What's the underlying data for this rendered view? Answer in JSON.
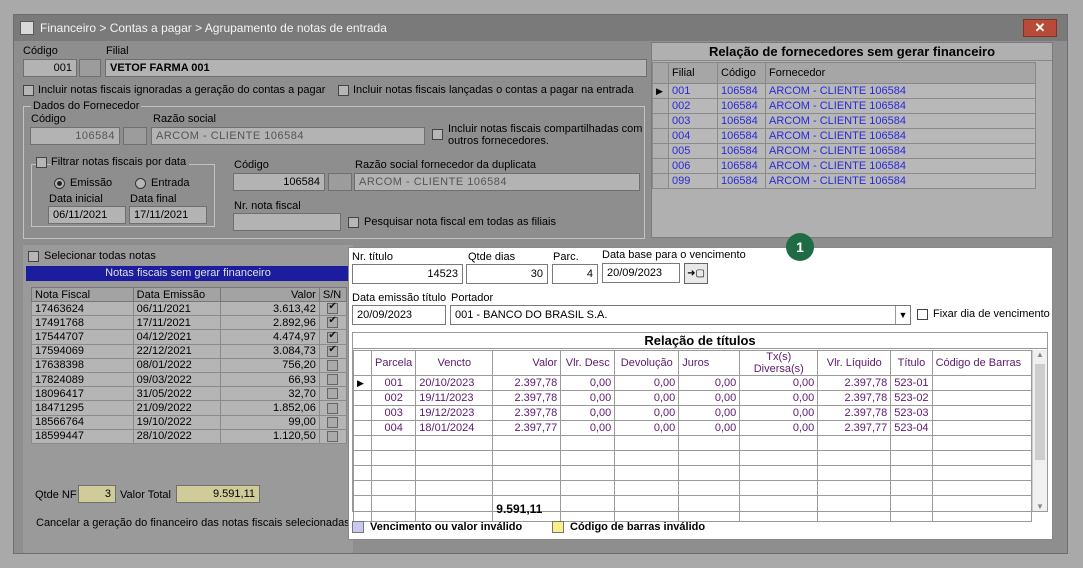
{
  "window": {
    "title": "Financeiro > Contas a pagar > Agrupamento de notas de entrada",
    "close_label": "✕"
  },
  "header": {
    "codigo_label": "Código",
    "codigo_value": "001",
    "filial_label": "Filial",
    "filial_value": "VETOF FARMA 001",
    "chk_ignoradas": "Incluir notas fiscais ignoradas a geração do contas a pagar",
    "chk_lancadas": "Incluir notas fiscais lançadas o contas a pagar na entrada"
  },
  "fornecedor": {
    "group_label": "Dados do Fornecedor",
    "codigo_label": "Código",
    "codigo_value": "106584",
    "razao_label": "Razão social",
    "razao_value": "ARCOM - CLIENTE 106584",
    "chk_compartilhadas": "Incluir notas fiscais compartilhadas com outros fornecedores.",
    "filtrar_label": "Filtrar notas fiscais por data",
    "radio_emissao": "Emissão",
    "radio_entrada": "Entrada",
    "data_inicial_label": "Data inicial",
    "data_inicial_value": "06/11/2021",
    "data_final_label": "Data final",
    "data_final_value": "17/11/2021",
    "codigo2_label": "Código",
    "codigo2_value": "106584",
    "razao_dup_label": "Razão social fornecedor da duplicata",
    "razao_dup_value": "ARCOM - CLIENTE 106584",
    "nr_nota_label": "Nr. nota fiscal",
    "nr_nota_value": "",
    "chk_todas_filiais": "Pesquisar nota fiscal em todas as filiais"
  },
  "suppliers": {
    "title": "Relação de fornecedores sem gerar financeiro",
    "headers": [
      "Filial",
      "Código",
      "Fornecedor"
    ],
    "rows": [
      [
        "001",
        "106584",
        "ARCOM - CLIENTE 106584"
      ],
      [
        "002",
        "106584",
        "ARCOM - CLIENTE 106584"
      ],
      [
        "003",
        "106584",
        "ARCOM - CLIENTE 106584"
      ],
      [
        "004",
        "106584",
        "ARCOM - CLIENTE 106584"
      ],
      [
        "005",
        "106584",
        "ARCOM - CLIENTE 106584"
      ],
      [
        "006",
        "106584",
        "ARCOM - CLIENTE 106584"
      ],
      [
        "099",
        "106584",
        "ARCOM - CLIENTE 106584"
      ]
    ]
  },
  "invoices": {
    "select_all_label": "Selecionar todas notas",
    "title": "Notas fiscais sem gerar financeiro",
    "headers": [
      "Nota Fiscal",
      "Data Emissão",
      "Valor",
      "S/N"
    ],
    "rows": [
      [
        "17463624",
        "06/11/2021",
        "3.613,42",
        true
      ],
      [
        "17491768",
        "17/11/2021",
        "2.892,96",
        true
      ],
      [
        "17544707",
        "04/12/2021",
        "4.474,97",
        true
      ],
      [
        "17594069",
        "22/12/2021",
        "3.084,73",
        true
      ],
      [
        "17638398",
        "08/01/2022",
        "756,20",
        false
      ],
      [
        "17824089",
        "09/03/2022",
        "66,93",
        false
      ],
      [
        "18096417",
        "31/05/2022",
        "32,70",
        false
      ],
      [
        "18471295",
        "21/09/2022",
        "1.852,06",
        false
      ],
      [
        "18566764",
        "19/10/2022",
        "99,00",
        false
      ],
      [
        "18599447",
        "28/10/2022",
        "1.120,50",
        false
      ]
    ],
    "qtde_nf_label": "Qtde NF",
    "qtde_nf_value": "3",
    "valor_total_label": "Valor Total",
    "valor_total_value": "9.591,11",
    "cancel_label": "Cancelar a geração do financeiro das notas fiscais selecionadas"
  },
  "titulo_form": {
    "nr_titulo_label": "Nr. título",
    "nr_titulo_value": "14523",
    "qtde_dias_label": "Qtde dias",
    "qtde_dias_value": "30",
    "parc_label": "Parc.",
    "parc_value": "4",
    "data_base_label": "Data base para o vencimento",
    "data_base_value": "20/09/2023",
    "apply_icon": "➜▢",
    "data_emissao_label": "Data emissão título",
    "data_emissao_value": "20/09/2023",
    "portador_label": "Portador",
    "portador_value": "001 - BANCO DO BRASIL S.A.",
    "fixar_label": "Fixar dia de vencimento"
  },
  "titulos": {
    "title": "Relação de títulos",
    "headers": [
      "Parcela",
      "Vencto",
      "Valor",
      "Vlr. Desc",
      "Devolução",
      "Juros",
      "Tx(s) Diversa(s)",
      "Vlr. Líquido",
      "Título",
      "Código de Barras"
    ],
    "rows": [
      [
        "001",
        "20/10/2023",
        "2.397,78",
        "0,00",
        "0,00",
        "0,00",
        "0,00",
        "2.397,78",
        "523-01",
        ""
      ],
      [
        "002",
        "19/11/2023",
        "2.397,78",
        "0,00",
        "0,00",
        "0,00",
        "0,00",
        "2.397,78",
        "523-02",
        ""
      ],
      [
        "003",
        "19/12/2023",
        "2.397,78",
        "0,00",
        "0,00",
        "0,00",
        "0,00",
        "2.397,78",
        "523-03",
        ""
      ],
      [
        "004",
        "18/01/2024",
        "2.397,77",
        "0,00",
        "0,00",
        "0,00",
        "0,00",
        "2.397,77",
        "523-04",
        ""
      ]
    ],
    "total": "9.591,11"
  },
  "legend": {
    "invalid_due": "Vencimento ou valor inválido",
    "invalid_barcode": "Código de barras inválido",
    "invalid_due_color": "#c8c8f0",
    "invalid_barcode_color": "#f5f08a"
  },
  "badge": "1"
}
